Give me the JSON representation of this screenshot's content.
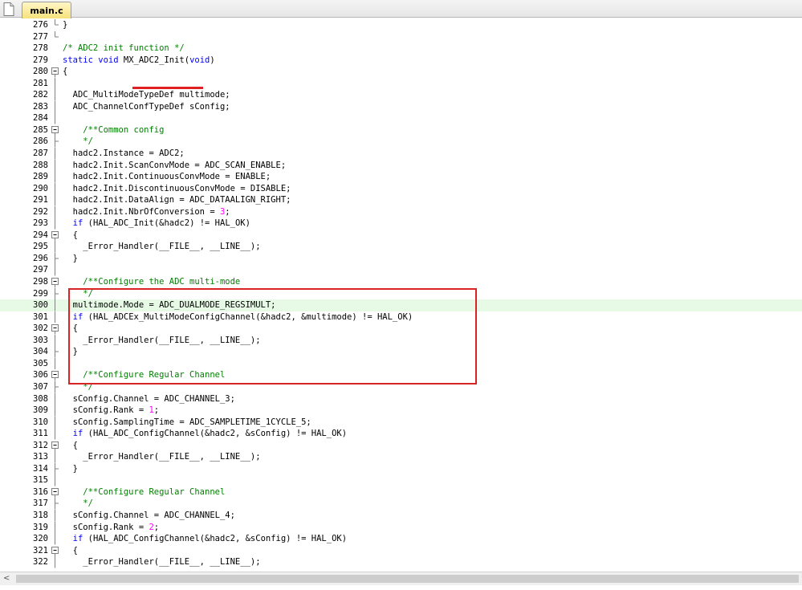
{
  "tab": {
    "label": "main.c",
    "icon": "file-icon"
  },
  "colors": {
    "keyword": "#0000ff",
    "comment": "#008000",
    "number": "#ff00ff",
    "highlight_line": "#e6fae6",
    "annotation": "#d82424"
  },
  "lines": [
    {
      "n": "276",
      "fold": "end",
      "tokens": [
        [
          "tx",
          "}"
        ]
      ]
    },
    {
      "n": "277",
      "fold": "endl",
      "tokens": []
    },
    {
      "n": "278",
      "fold": "",
      "tokens": [
        [
          "cm",
          "/* ADC2 init function */"
        ]
      ]
    },
    {
      "n": "279",
      "fold": "",
      "tokens": [
        [
          "kw",
          "static"
        ],
        [
          "tx",
          " "
        ],
        [
          "kw",
          "void"
        ],
        [
          "tx",
          " MX_ADC2_Init("
        ],
        [
          "kw",
          "void"
        ],
        [
          "tx",
          ")"
        ]
      ]
    },
    {
      "n": "280",
      "fold": "box",
      "tokens": [
        [
          "tx",
          "{"
        ]
      ]
    },
    {
      "n": "281",
      "fold": "bar",
      "tokens": []
    },
    {
      "n": "282",
      "fold": "bar",
      "tokens": [
        [
          "tx",
          "  ADC_MultiModeTypeDef multimode;"
        ]
      ]
    },
    {
      "n": "283",
      "fold": "bar",
      "tokens": [
        [
          "tx",
          "  ADC_ChannelConfTypeDef sConfig;"
        ]
      ]
    },
    {
      "n": "284",
      "fold": "bar",
      "tokens": []
    },
    {
      "n": "285",
      "fold": "box",
      "tokens": [
        [
          "cm",
          "    /**Common config"
        ]
      ]
    },
    {
      "n": "286",
      "fold": "endl",
      "tokens": [
        [
          "cm",
          "    */"
        ]
      ]
    },
    {
      "n": "287",
      "fold": "bar",
      "tokens": [
        [
          "tx",
          "  hadc2.Instance = ADC2;"
        ]
      ]
    },
    {
      "n": "288",
      "fold": "bar",
      "tokens": [
        [
          "tx",
          "  hadc2.Init.ScanConvMode = ADC_SCAN_ENABLE;"
        ]
      ]
    },
    {
      "n": "289",
      "fold": "bar",
      "tokens": [
        [
          "tx",
          "  hadc2.Init.ContinuousConvMode = ENABLE;"
        ]
      ]
    },
    {
      "n": "290",
      "fold": "bar",
      "tokens": [
        [
          "tx",
          "  hadc2.Init.DiscontinuousConvMode = DISABLE;"
        ]
      ]
    },
    {
      "n": "291",
      "fold": "bar",
      "tokens": [
        [
          "tx",
          "  hadc2.Init.DataAlign = ADC_DATAALIGN_RIGHT;"
        ]
      ]
    },
    {
      "n": "292",
      "fold": "bar",
      "tokens": [
        [
          "tx",
          "  hadc2.Init.NbrOfConversion = "
        ],
        [
          "num",
          "3"
        ],
        [
          "tx",
          ";"
        ]
      ]
    },
    {
      "n": "293",
      "fold": "bar",
      "tokens": [
        [
          "tx",
          "  "
        ],
        [
          "kw",
          "if"
        ],
        [
          "tx",
          " (HAL_ADC_Init(&hadc2) != HAL_OK)"
        ]
      ]
    },
    {
      "n": "294",
      "fold": "box",
      "tokens": [
        [
          "tx",
          "  {"
        ]
      ]
    },
    {
      "n": "295",
      "fold": "bar",
      "tokens": [
        [
          "tx",
          "    _Error_Handler(__FILE__, __LINE__);"
        ]
      ]
    },
    {
      "n": "296",
      "fold": "endl",
      "tokens": [
        [
          "tx",
          "  }"
        ]
      ]
    },
    {
      "n": "297",
      "fold": "bar",
      "tokens": []
    },
    {
      "n": "298",
      "fold": "box",
      "tokens": [
        [
          "cm",
          "    /**Configure the ADC multi-mode"
        ]
      ]
    },
    {
      "n": "299",
      "fold": "endl",
      "tokens": [
        [
          "cm",
          "    */"
        ]
      ]
    },
    {
      "n": "300",
      "fold": "bar",
      "hl": true,
      "tokens": [
        [
          "tx",
          "  multimode.Mode = ADC_DUALMODE_REGSIMULT;"
        ]
      ]
    },
    {
      "n": "301",
      "fold": "bar",
      "tokens": [
        [
          "tx",
          "  "
        ],
        [
          "kw",
          "if"
        ],
        [
          "tx",
          " (HAL_ADCEx_MultiModeConfigChannel(&hadc2, &multimode) != HAL_OK)"
        ]
      ]
    },
    {
      "n": "302",
      "fold": "box",
      "tokens": [
        [
          "tx",
          "  {"
        ]
      ]
    },
    {
      "n": "303",
      "fold": "bar",
      "tokens": [
        [
          "tx",
          "    _Error_Handler(__FILE__, __LINE__);"
        ]
      ]
    },
    {
      "n": "304",
      "fold": "endl",
      "tokens": [
        [
          "tx",
          "  }"
        ]
      ]
    },
    {
      "n": "305",
      "fold": "bar",
      "tokens": []
    },
    {
      "n": "306",
      "fold": "box",
      "tokens": [
        [
          "cm",
          "    /**Configure Regular Channel"
        ]
      ]
    },
    {
      "n": "307",
      "fold": "endl",
      "tokens": [
        [
          "cm",
          "    */"
        ]
      ]
    },
    {
      "n": "308",
      "fold": "bar",
      "tokens": [
        [
          "tx",
          "  sConfig.Channel = ADC_CHANNEL_3;"
        ]
      ]
    },
    {
      "n": "309",
      "fold": "bar",
      "tokens": [
        [
          "tx",
          "  sConfig.Rank = "
        ],
        [
          "num",
          "1"
        ],
        [
          "tx",
          ";"
        ]
      ]
    },
    {
      "n": "310",
      "fold": "bar",
      "tokens": [
        [
          "tx",
          "  sConfig.SamplingTime = ADC_SAMPLETIME_1CYCLE_5;"
        ]
      ]
    },
    {
      "n": "311",
      "fold": "bar",
      "tokens": [
        [
          "tx",
          "  "
        ],
        [
          "kw",
          "if"
        ],
        [
          "tx",
          " (HAL_ADC_ConfigChannel(&hadc2, &sConfig) != HAL_OK)"
        ]
      ]
    },
    {
      "n": "312",
      "fold": "box",
      "tokens": [
        [
          "tx",
          "  {"
        ]
      ]
    },
    {
      "n": "313",
      "fold": "bar",
      "tokens": [
        [
          "tx",
          "    _Error_Handler(__FILE__, __LINE__);"
        ]
      ]
    },
    {
      "n": "314",
      "fold": "endl",
      "tokens": [
        [
          "tx",
          "  }"
        ]
      ]
    },
    {
      "n": "315",
      "fold": "bar",
      "tokens": []
    },
    {
      "n": "316",
      "fold": "box",
      "tokens": [
        [
          "cm",
          "    /**Configure Regular Channel"
        ]
      ]
    },
    {
      "n": "317",
      "fold": "endl",
      "tokens": [
        [
          "cm",
          "    */"
        ]
      ]
    },
    {
      "n": "318",
      "fold": "bar",
      "tokens": [
        [
          "tx",
          "  sConfig.Channel = ADC_CHANNEL_4;"
        ]
      ]
    },
    {
      "n": "319",
      "fold": "bar",
      "tokens": [
        [
          "tx",
          "  sConfig.Rank = "
        ],
        [
          "num",
          "2"
        ],
        [
          "tx",
          ";"
        ]
      ]
    },
    {
      "n": "320",
      "fold": "bar",
      "tokens": [
        [
          "tx",
          "  "
        ],
        [
          "kw",
          "if"
        ],
        [
          "tx",
          " (HAL_ADC_ConfigChannel(&hadc2, &sConfig) != HAL_OK)"
        ]
      ]
    },
    {
      "n": "321",
      "fold": "box",
      "tokens": [
        [
          "tx",
          "  {"
        ]
      ]
    },
    {
      "n": "322",
      "fold": "bar",
      "tokens": [
        [
          "tx",
          "    _Error_Handler(__FILE__, __LINE__);"
        ]
      ]
    }
  ],
  "scrollbar": {
    "left_arrow": "<"
  }
}
